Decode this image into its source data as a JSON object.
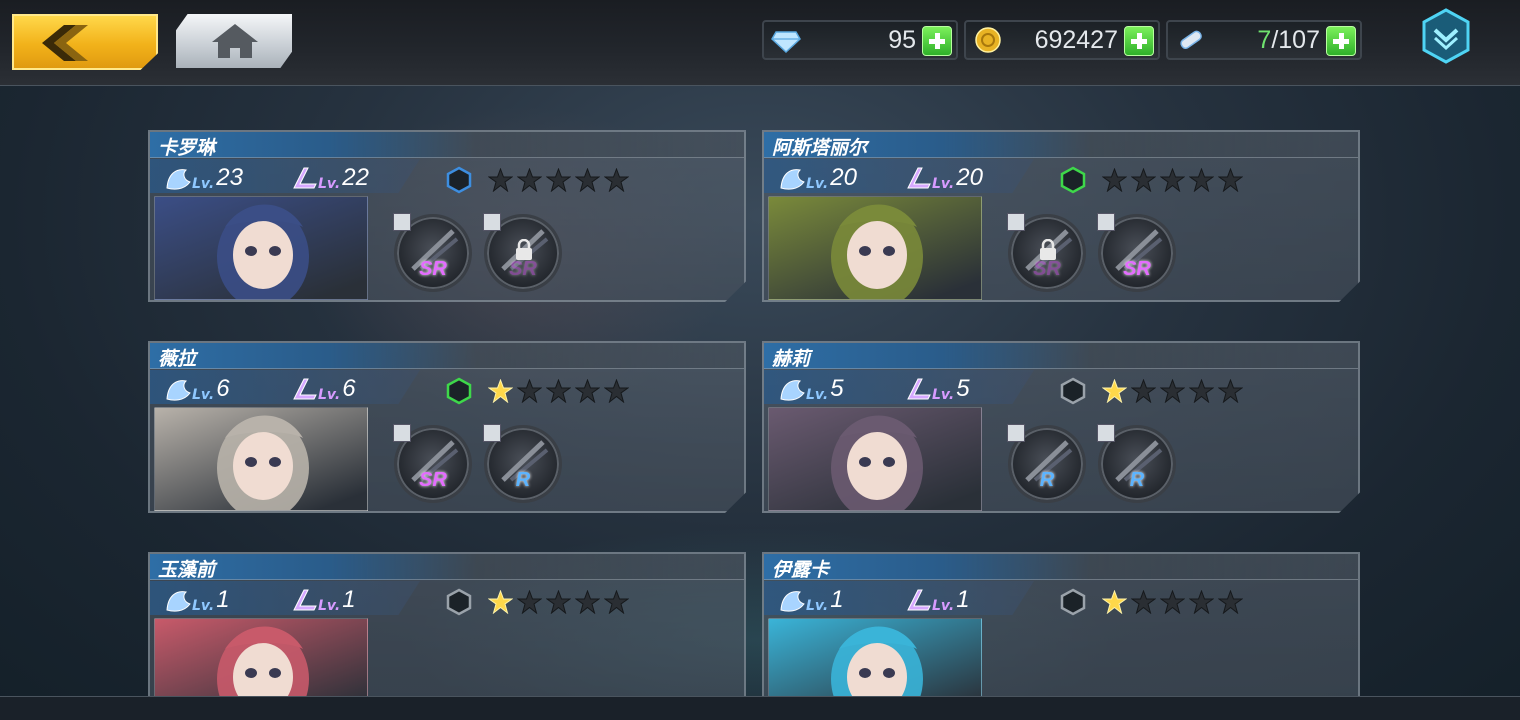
{
  "top_bar": {
    "back_icon": "back-arrow-icon",
    "home_icon": "home-icon",
    "resources": [
      {
        "icon": "diamond-icon",
        "value": "95"
      },
      {
        "icon": "gold-coin-icon",
        "value": "692427"
      },
      {
        "icon": "stamina-icon",
        "value_current": "7",
        "value_max": "/107"
      }
    ],
    "menu_icon": "dropdown-menu-icon"
  },
  "characters": [
    {
      "name": "卡罗琳",
      "lv_a": "23",
      "lv_b": "22",
      "lv_label": "Lv.",
      "hex_color": "#3d8ee0",
      "stars_lit": 0,
      "portrait_color": "#3b4e86",
      "equipment": [
        {
          "rank": "SR",
          "locked": false
        },
        {
          "rank": "SR",
          "locked": true
        }
      ]
    },
    {
      "name": "阿斯塔丽尔",
      "lv_a": "20",
      "lv_b": "20",
      "lv_label": "Lv.",
      "hex_color": "#3ed84a",
      "stars_lit": 0,
      "portrait_color": "#7a8a3a",
      "equipment": [
        {
          "rank": "SR",
          "locked": true
        },
        {
          "rank": "SR",
          "locked": false
        }
      ]
    },
    {
      "name": "薇拉",
      "lv_a": "6",
      "lv_b": "6",
      "lv_label": "Lv.",
      "hex_color": "#3ed84a",
      "stars_lit": 1,
      "portrait_color": "#b8b2aa",
      "equipment": [
        {
          "rank": "SR",
          "locked": false
        },
        {
          "rank": "R",
          "locked": false
        }
      ]
    },
    {
      "name": "赫莉",
      "lv_a": "5",
      "lv_b": "5",
      "lv_label": "Lv.",
      "hex_color": "#9aa2aa",
      "stars_lit": 1,
      "portrait_color": "#6a5a70",
      "equipment": [
        {
          "rank": "R",
          "locked": false
        },
        {
          "rank": "R",
          "locked": false
        }
      ]
    },
    {
      "name": "玉藻前",
      "lv_a": "1",
      "lv_b": "1",
      "lv_label": "Lv.",
      "hex_color": "#9aa2aa",
      "stars_lit": 1,
      "portrait_color": "#c85a6a",
      "equipment": []
    },
    {
      "name": "伊露卡",
      "lv_a": "1",
      "lv_b": "1",
      "lv_label": "Lv.",
      "hex_color": "#9aa2aa",
      "stars_lit": 1,
      "portrait_color": "#3ab4d8",
      "equipment": []
    }
  ]
}
